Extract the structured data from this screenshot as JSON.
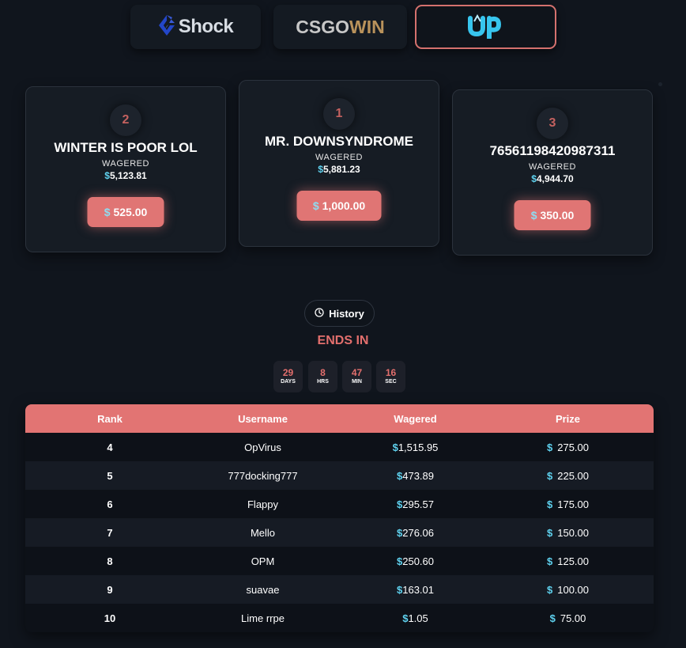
{
  "brands": [
    {
      "name": "Shock",
      "icon": "shock-logo-icon"
    },
    {
      "name_a": "CSGO",
      "name_b": "WIN"
    },
    {
      "icon": "up-logo-icon",
      "active": true
    }
  ],
  "podium": [
    {
      "rank": "2",
      "name": "WINTER IS POOR LOL",
      "label": "WAGERED",
      "wagered": "5,123.81",
      "prize": "525.00"
    },
    {
      "rank": "1",
      "name": "MR. DOWNSYNDROME",
      "label": "WAGERED",
      "wagered": "5,881.23",
      "prize": "1,000.00"
    },
    {
      "rank": "3",
      "name": "76561198420987311",
      "label": "WAGERED",
      "wagered": "4,944.70",
      "prize": "350.00"
    }
  ],
  "currency": "$",
  "history": {
    "label": "History",
    "icon": "clock-icon"
  },
  "ends_in": "ENDS IN",
  "countdown": [
    {
      "value": "29",
      "unit": "DAYS"
    },
    {
      "value": "8",
      "unit": "HRS"
    },
    {
      "value": "47",
      "unit": "MIN"
    },
    {
      "value": "16",
      "unit": "SEC"
    }
  ],
  "table": {
    "headers": [
      "Rank",
      "Username",
      "Wagered",
      "Prize"
    ],
    "rows": [
      {
        "rank": "4",
        "username": "OpVirus",
        "wagered": "1,515.95",
        "prize": "275.00"
      },
      {
        "rank": "5",
        "username": "777docking777",
        "wagered": "473.89",
        "prize": "225.00"
      },
      {
        "rank": "6",
        "username": "Flappy",
        "wagered": "295.57",
        "prize": "175.00"
      },
      {
        "rank": "7",
        "username": "Mello",
        "wagered": "276.06",
        "prize": "150.00"
      },
      {
        "rank": "8",
        "username": "OPM",
        "wagered": "250.60",
        "prize": "125.00"
      },
      {
        "rank": "9",
        "username": "suavae",
        "wagered": "163.01",
        "prize": "100.00"
      },
      {
        "rank": "10",
        "username": "Lime rrpe",
        "wagered": "1.05",
        "prize": "75.00"
      }
    ]
  },
  "colors": {
    "accent": "#e27473",
    "currency": "#5fd2ef",
    "background": "#10151d"
  }
}
